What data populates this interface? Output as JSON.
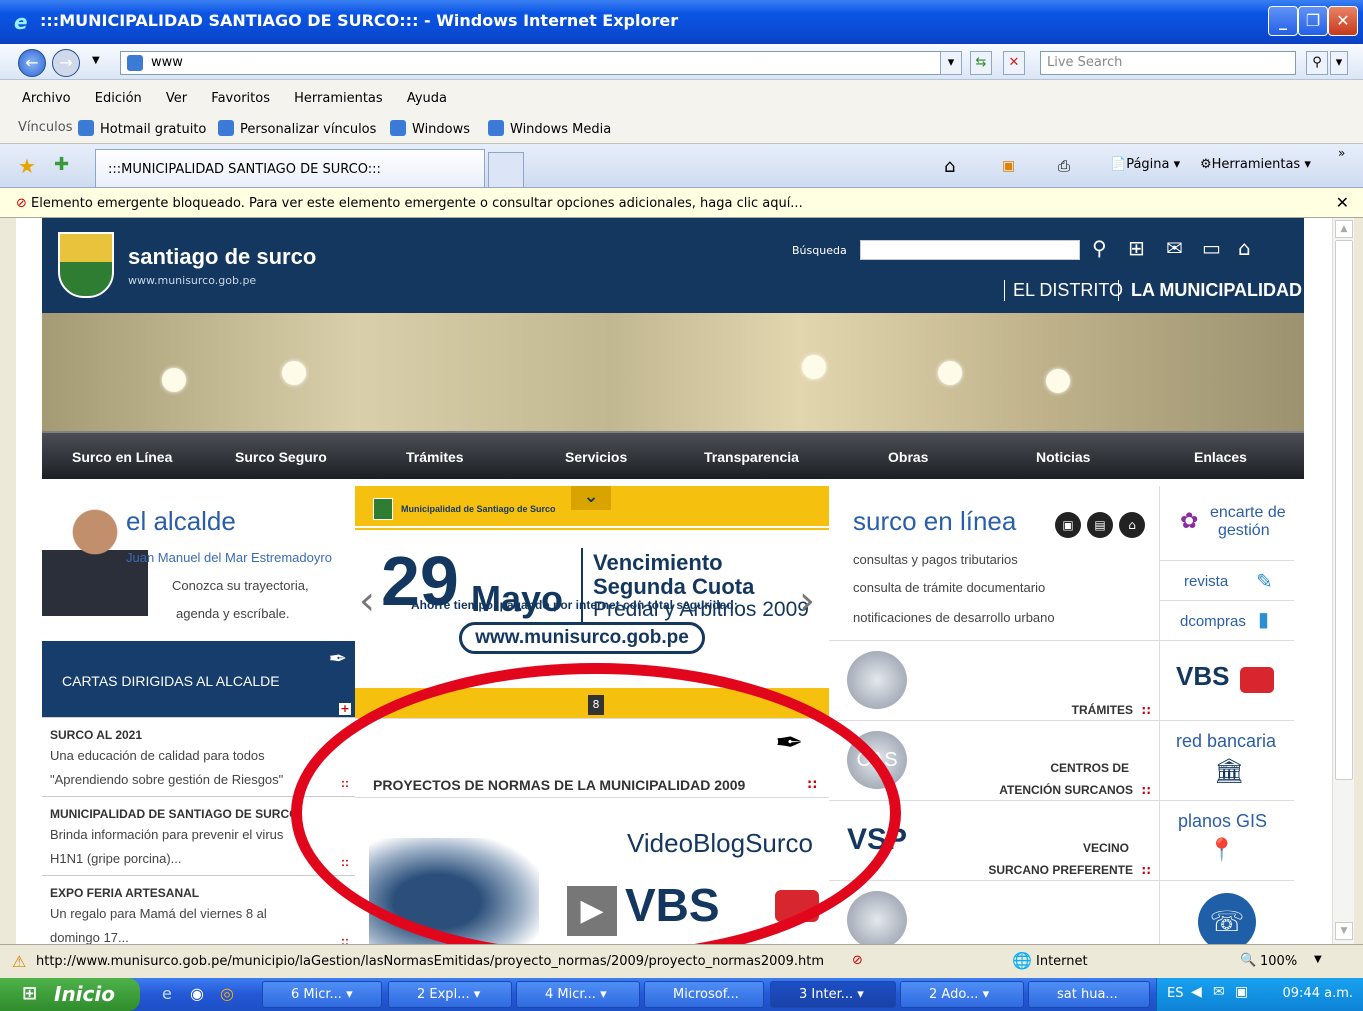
{
  "window": {
    "title": ":::MUNICIPALIDAD SANTIAGO DE SURCO::: - Windows Internet Explorer"
  },
  "address": {
    "url": "www",
    "search_placeholder": "Live Search"
  },
  "menu": [
    "Archivo",
    "Edición",
    "Ver",
    "Favoritos",
    "Herramientas",
    "Ayuda"
  ],
  "links": {
    "label": "Vínculos",
    "items": [
      "Hotmail gratuito",
      "Personalizar vínculos",
      "Windows",
      "Windows Media"
    ]
  },
  "tab": {
    "title": ":::MUNICIPALIDAD SANTIAGO DE SURCO:::",
    "pagina": "Página",
    "herramientas": "Herramientas"
  },
  "popup_bar": {
    "text": "Elemento emergente bloqueado. Para ver este elemento emergente o consultar opciones adicionales, haga clic aquí..."
  },
  "site": {
    "brand": "santiago de surco",
    "brand_url": "www.munisurco.gob.pe",
    "search_label": "Búsqueda",
    "el_distrito": "EL DISTRITO",
    "la_municipalidad": "LA MUNICIPALIDAD",
    "nav": [
      "Surco en Línea",
      "Surco Seguro",
      "Trámites",
      "Servicios",
      "Transparencia",
      "Obras",
      "Noticias",
      "Enlaces"
    ],
    "alcalde": {
      "title": "el alcalde",
      "name": "Juan Manuel del Mar Estremadoyro",
      "desc1": "Conozca su trayectoria,",
      "desc2": "agenda y escríbale."
    },
    "cartas": "CARTAS DIRIGIDAS AL ALCALDE",
    "news": [
      {
        "h": "SURCO AL 2021",
        "l1": "Una educación de calidad para todos",
        "l2": "\"Aprendiendo sobre gestión de Riesgos\""
      },
      {
        "h": "MUNICIPALIDAD DE SANTIAGO DE SURCO",
        "l1": "Brinda información para prevenir el virus",
        "l2": "H1N1 (gripe porcina)..."
      },
      {
        "h": "EXPO FERIA ARTESANAL",
        "l1": "Un regalo para Mamá del viernes 8 al",
        "l2": "domingo 17..."
      }
    ],
    "promo": {
      "header": "Municipalidad de Santiago de Surco",
      "day": "29",
      "month": "Mayo",
      "v1": "Vencimiento",
      "v2": "Segunda Cuota",
      "v3": "Predial y Arbitrios 2009",
      "ahorre": "Ahorre tiempo, pagando por internet con total seguridad:",
      "url": "www.munisurco.gob.pe",
      "slide": "8"
    },
    "proyectos": "PROYECTOS DE NORMAS DE LA MUNICIPALIDAD 2009",
    "videoblog": "VideoBlogSurco",
    "vbs": "VBS",
    "surco_en_linea": {
      "title": "surco en línea",
      "items": [
        "consultas y pagos tributarios",
        "consulta de trámite documentario",
        "notificaciones de desarrollo urbano"
      ]
    },
    "services": [
      {
        "logo": "",
        "l1": "",
        "l2": "TRÁMITES"
      },
      {
        "logo": "CAS",
        "l1": "CENTROS DE",
        "l2": "ATENCIÓN SURCANOS"
      },
      {
        "logo": "VSP",
        "l1": "VECINO",
        "l2": "SURCANO PREFERENTE"
      }
    ],
    "right": {
      "encarte1": "encarte de",
      "encarte2": "gestión",
      "revista": "revista",
      "dcompras": "dcompras",
      "vbs": "VBS",
      "red": "red bancaria",
      "planos": "planos GIS"
    },
    "dots": "::"
  },
  "status": {
    "url": "http://www.munisurco.gob.pe/municipio/laGestion/lasNormasEmitidas/proyecto_normas/2009/proyecto_normas2009.htm",
    "zone": "Internet",
    "zoom": "100%"
  },
  "taskbar": {
    "start": "Inicio",
    "tasks": [
      "6 Micr...",
      "2 Expl...",
      "4 Micr...",
      "Microsof...",
      "3 Inter...",
      "2 Ado...",
      "sat hua..."
    ],
    "lang": "ES",
    "time": "09:44 a.m."
  }
}
